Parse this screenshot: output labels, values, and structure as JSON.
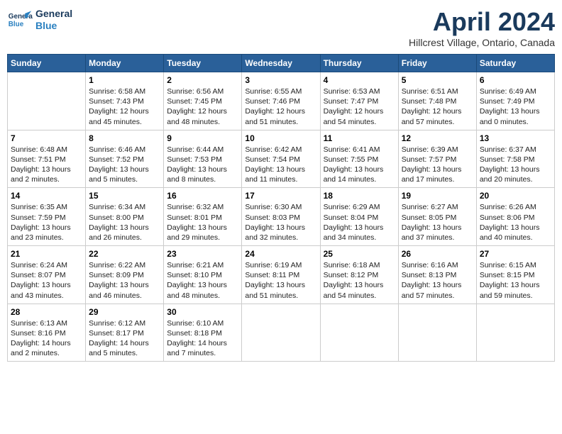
{
  "header": {
    "logo_line1": "General",
    "logo_line2": "Blue",
    "month": "April 2024",
    "location": "Hillcrest Village, Ontario, Canada"
  },
  "weekdays": [
    "Sunday",
    "Monday",
    "Tuesday",
    "Wednesday",
    "Thursday",
    "Friday",
    "Saturday"
  ],
  "weeks": [
    [
      {
        "day": "",
        "info": ""
      },
      {
        "day": "1",
        "info": "Sunrise: 6:58 AM\nSunset: 7:43 PM\nDaylight: 12 hours\nand 45 minutes."
      },
      {
        "day": "2",
        "info": "Sunrise: 6:56 AM\nSunset: 7:45 PM\nDaylight: 12 hours\nand 48 minutes."
      },
      {
        "day": "3",
        "info": "Sunrise: 6:55 AM\nSunset: 7:46 PM\nDaylight: 12 hours\nand 51 minutes."
      },
      {
        "day": "4",
        "info": "Sunrise: 6:53 AM\nSunset: 7:47 PM\nDaylight: 12 hours\nand 54 minutes."
      },
      {
        "day": "5",
        "info": "Sunrise: 6:51 AM\nSunset: 7:48 PM\nDaylight: 12 hours\nand 57 minutes."
      },
      {
        "day": "6",
        "info": "Sunrise: 6:49 AM\nSunset: 7:49 PM\nDaylight: 13 hours\nand 0 minutes."
      }
    ],
    [
      {
        "day": "7",
        "info": "Sunrise: 6:48 AM\nSunset: 7:51 PM\nDaylight: 13 hours\nand 2 minutes."
      },
      {
        "day": "8",
        "info": "Sunrise: 6:46 AM\nSunset: 7:52 PM\nDaylight: 13 hours\nand 5 minutes."
      },
      {
        "day": "9",
        "info": "Sunrise: 6:44 AM\nSunset: 7:53 PM\nDaylight: 13 hours\nand 8 minutes."
      },
      {
        "day": "10",
        "info": "Sunrise: 6:42 AM\nSunset: 7:54 PM\nDaylight: 13 hours\nand 11 minutes."
      },
      {
        "day": "11",
        "info": "Sunrise: 6:41 AM\nSunset: 7:55 PM\nDaylight: 13 hours\nand 14 minutes."
      },
      {
        "day": "12",
        "info": "Sunrise: 6:39 AM\nSunset: 7:57 PM\nDaylight: 13 hours\nand 17 minutes."
      },
      {
        "day": "13",
        "info": "Sunrise: 6:37 AM\nSunset: 7:58 PM\nDaylight: 13 hours\nand 20 minutes."
      }
    ],
    [
      {
        "day": "14",
        "info": "Sunrise: 6:35 AM\nSunset: 7:59 PM\nDaylight: 13 hours\nand 23 minutes."
      },
      {
        "day": "15",
        "info": "Sunrise: 6:34 AM\nSunset: 8:00 PM\nDaylight: 13 hours\nand 26 minutes."
      },
      {
        "day": "16",
        "info": "Sunrise: 6:32 AM\nSunset: 8:01 PM\nDaylight: 13 hours\nand 29 minutes."
      },
      {
        "day": "17",
        "info": "Sunrise: 6:30 AM\nSunset: 8:03 PM\nDaylight: 13 hours\nand 32 minutes."
      },
      {
        "day": "18",
        "info": "Sunrise: 6:29 AM\nSunset: 8:04 PM\nDaylight: 13 hours\nand 34 minutes."
      },
      {
        "day": "19",
        "info": "Sunrise: 6:27 AM\nSunset: 8:05 PM\nDaylight: 13 hours\nand 37 minutes."
      },
      {
        "day": "20",
        "info": "Sunrise: 6:26 AM\nSunset: 8:06 PM\nDaylight: 13 hours\nand 40 minutes."
      }
    ],
    [
      {
        "day": "21",
        "info": "Sunrise: 6:24 AM\nSunset: 8:07 PM\nDaylight: 13 hours\nand 43 minutes."
      },
      {
        "day": "22",
        "info": "Sunrise: 6:22 AM\nSunset: 8:09 PM\nDaylight: 13 hours\nand 46 minutes."
      },
      {
        "day": "23",
        "info": "Sunrise: 6:21 AM\nSunset: 8:10 PM\nDaylight: 13 hours\nand 48 minutes."
      },
      {
        "day": "24",
        "info": "Sunrise: 6:19 AM\nSunset: 8:11 PM\nDaylight: 13 hours\nand 51 minutes."
      },
      {
        "day": "25",
        "info": "Sunrise: 6:18 AM\nSunset: 8:12 PM\nDaylight: 13 hours\nand 54 minutes."
      },
      {
        "day": "26",
        "info": "Sunrise: 6:16 AM\nSunset: 8:13 PM\nDaylight: 13 hours\nand 57 minutes."
      },
      {
        "day": "27",
        "info": "Sunrise: 6:15 AM\nSunset: 8:15 PM\nDaylight: 13 hours\nand 59 minutes."
      }
    ],
    [
      {
        "day": "28",
        "info": "Sunrise: 6:13 AM\nSunset: 8:16 PM\nDaylight: 14 hours\nand 2 minutes."
      },
      {
        "day": "29",
        "info": "Sunrise: 6:12 AM\nSunset: 8:17 PM\nDaylight: 14 hours\nand 5 minutes."
      },
      {
        "day": "30",
        "info": "Sunrise: 6:10 AM\nSunset: 8:18 PM\nDaylight: 14 hours\nand 7 minutes."
      },
      {
        "day": "",
        "info": ""
      },
      {
        "day": "",
        "info": ""
      },
      {
        "day": "",
        "info": ""
      },
      {
        "day": "",
        "info": ""
      }
    ]
  ]
}
